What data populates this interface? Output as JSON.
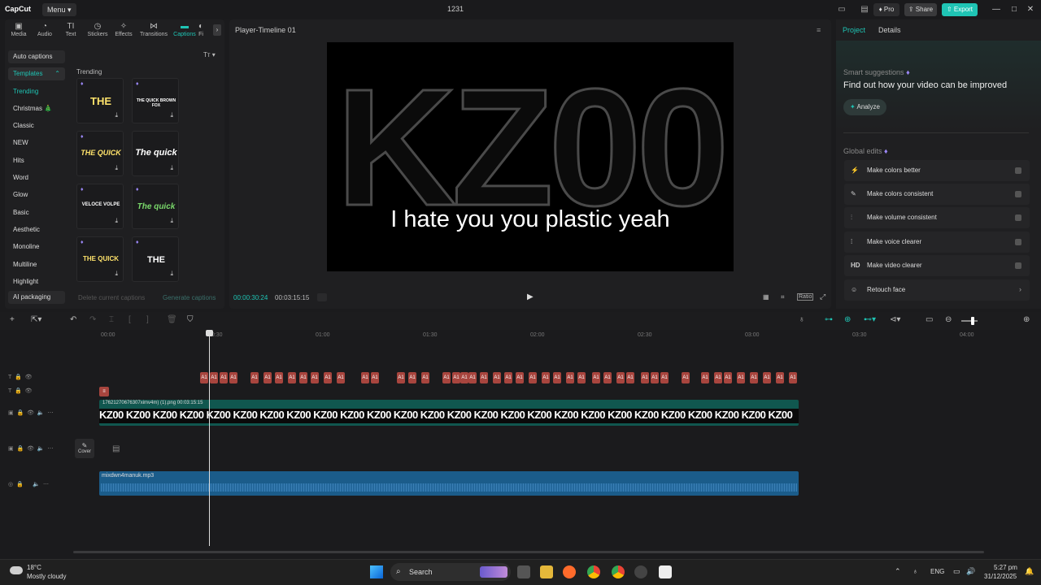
{
  "app": {
    "logo": "CapCut",
    "menu_label": "Menu",
    "project_title": "1231",
    "pro_label": "Pro",
    "share_label": "Share",
    "export_label": "Export",
    "accent": "#1fc4b4"
  },
  "toolbar": [
    {
      "label": "Media",
      "icon": "media-icon"
    },
    {
      "label": "Audio",
      "icon": "audio-icon"
    },
    {
      "label": "Text",
      "icon": "text-icon"
    },
    {
      "label": "Stickers",
      "icon": "stickers-icon"
    },
    {
      "label": "Effects",
      "icon": "effects-icon"
    },
    {
      "label": "Transitions",
      "icon": "transitions-icon"
    },
    {
      "label": "Captions",
      "icon": "captions-icon"
    },
    {
      "label": "Fi",
      "icon": "filters-icon"
    }
  ],
  "categories": [
    "Auto captions",
    "Templates",
    "Trending",
    "Christmas 🎄",
    "Classic",
    "NEW",
    "Hits",
    "Word",
    "Glow",
    "Basic",
    "Aesthetic",
    "Monoline",
    "Multiline",
    "Highlight",
    "AI packaging"
  ],
  "templates": {
    "section_label": "Trending",
    "items": [
      "THE",
      "THE QUICK BROWN FOX",
      "THE QUICK",
      "The quick",
      "VELOCE VOLPE",
      "The quick",
      "THE QUICK",
      "THE"
    ]
  },
  "caption_actions": {
    "delete": "Delete current captions",
    "generate": "Generate captions"
  },
  "player": {
    "title": "Player-Timeline 01",
    "video_text": "KZ00",
    "subtitle": "I hate you you plastic yeah",
    "current_time": "00:00:30:24",
    "total_time": "00:03:15:15",
    "ratio_label": "Ratio"
  },
  "right_panel": {
    "tabs": [
      "Project",
      "Details"
    ],
    "smart_suggestions": "Smart suggestions",
    "find_out": "Find out how your video can be improved",
    "analyze": "Analyze",
    "global_edits": "Global edits",
    "edits": [
      {
        "icon": "magic-wand-icon",
        "label": "Make colors better"
      },
      {
        "icon": "palette-icon",
        "label": "Make colors consistent"
      },
      {
        "icon": "volume-bars-icon",
        "label": "Make volume consistent"
      },
      {
        "icon": "voice-icon",
        "label": "Make voice clearer"
      },
      {
        "icon": "hd-icon",
        "label": "Make video clearer"
      },
      {
        "icon": "face-icon",
        "label": "Retouch face"
      }
    ]
  },
  "timeline": {
    "ruler": [
      "00:00",
      "00:30",
      "01:00",
      "01:30",
      "02:00",
      "02:30",
      "03:00",
      "03:30",
      "04:00"
    ],
    "video_clip_label": "17621270676307ximv4m) (1).png  00:03:15:15",
    "video_strip": "KZ00 KZ00 KZ00 KZ00 KZ00 KZ00 KZ00 KZ00 KZ00 KZ00 KZ00 KZ00 KZ00 KZ00 KZ00 KZ00 KZ00 KZ00 KZ00 KZ00 KZ00 KZ00 KZ00 KZ00 KZ00 KZ00",
    "cover_label": "Cover",
    "audio_label": "mixdwn4manuk.mp3",
    "caption_clip_label": "A1"
  },
  "taskbar": {
    "temp": "18°C",
    "weather": "Mostly cloudy",
    "search": "Search",
    "lang": "ENG",
    "time": "5:27 pm",
    "date": "31/12/2025"
  }
}
